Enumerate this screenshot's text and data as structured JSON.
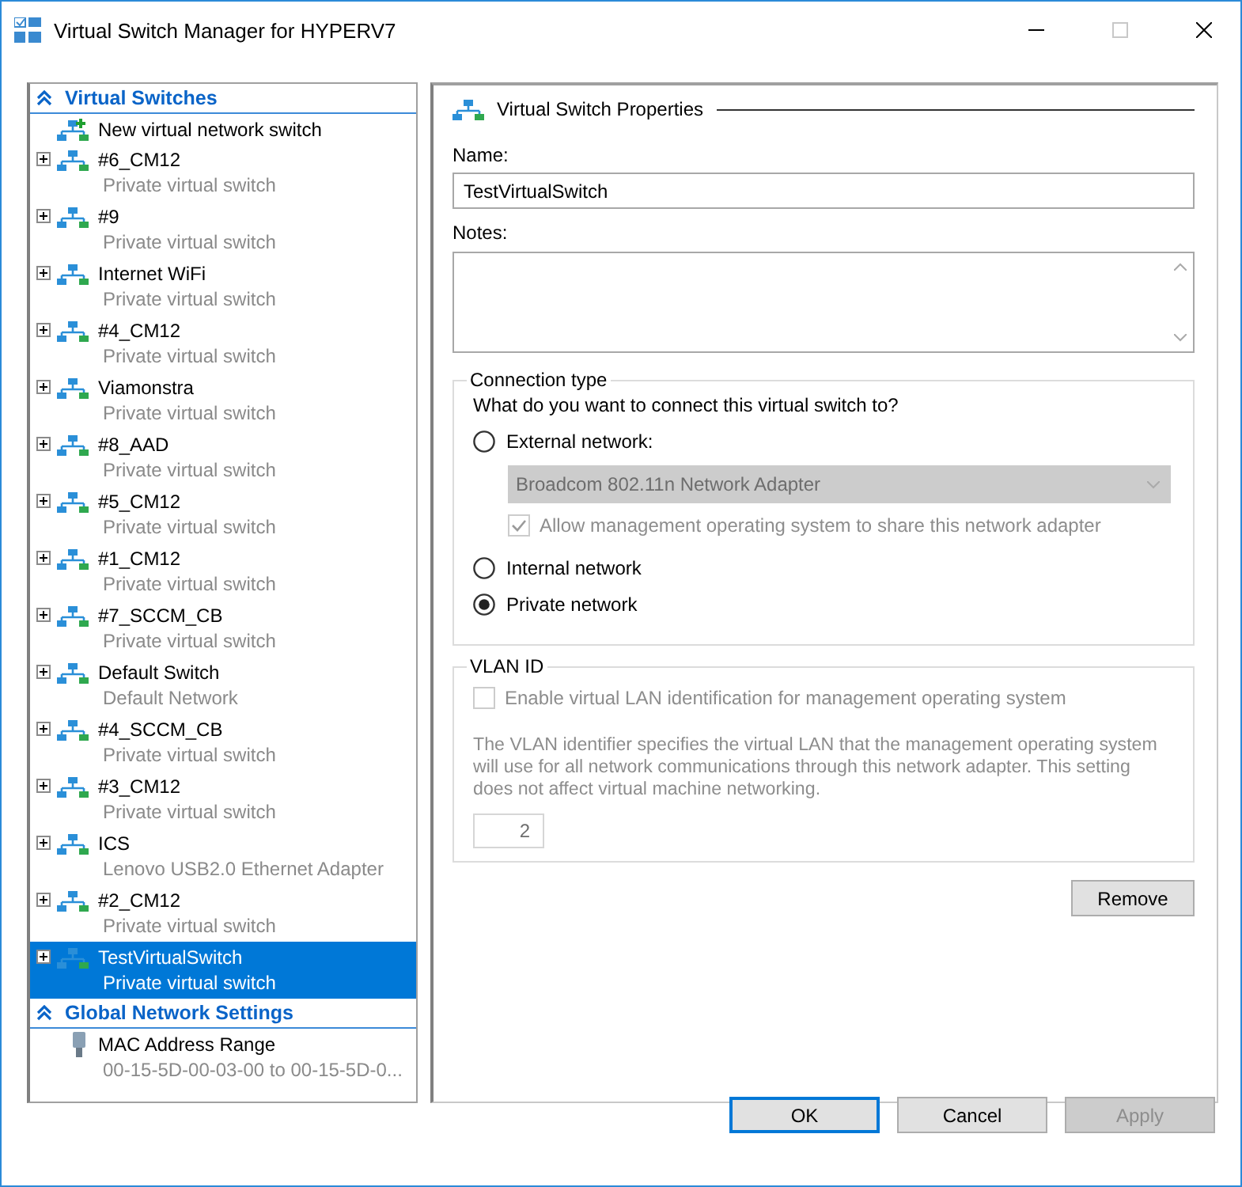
{
  "window": {
    "title": "Virtual Switch Manager for HYPERV7"
  },
  "sidebar": {
    "sections": [
      {
        "title": "Virtual Switches",
        "expanded": true,
        "items": [
          {
            "kind": "action",
            "name": "New virtual network switch",
            "selected": false
          },
          {
            "kind": "switch",
            "name": "#6_CM12",
            "subtitle": "Private virtual switch",
            "expanded": false,
            "selected": false
          },
          {
            "kind": "switch",
            "name": "#9",
            "subtitle": "Private virtual switch",
            "expanded": false,
            "selected": false
          },
          {
            "kind": "switch",
            "name": "Internet WiFi",
            "subtitle": "Private virtual switch",
            "expanded": false,
            "selected": false
          },
          {
            "kind": "switch",
            "name": "#4_CM12",
            "subtitle": "Private virtual switch",
            "expanded": false,
            "selected": false
          },
          {
            "kind": "switch",
            "name": "Viamonstra",
            "subtitle": "Private virtual switch",
            "expanded": false,
            "selected": false
          },
          {
            "kind": "switch",
            "name": "#8_AAD",
            "subtitle": "Private virtual switch",
            "expanded": false,
            "selected": false
          },
          {
            "kind": "switch",
            "name": "#5_CM12",
            "subtitle": "Private virtual switch",
            "expanded": false,
            "selected": false
          },
          {
            "kind": "switch",
            "name": "#1_CM12",
            "subtitle": "Private virtual switch",
            "expanded": false,
            "selected": false
          },
          {
            "kind": "switch",
            "name": "#7_SCCM_CB",
            "subtitle": "Private virtual switch",
            "expanded": false,
            "selected": false
          },
          {
            "kind": "switch",
            "name": "Default Switch",
            "subtitle": "Default Network",
            "expanded": false,
            "selected": false
          },
          {
            "kind": "switch",
            "name": "#4_SCCM_CB",
            "subtitle": "Private virtual switch",
            "expanded": false,
            "selected": false
          },
          {
            "kind": "switch",
            "name": "#3_CM12",
            "subtitle": "Private virtual switch",
            "expanded": false,
            "selected": false
          },
          {
            "kind": "switch",
            "name": "ICS",
            "subtitle": "Lenovo USB2.0 Ethernet Adapter",
            "expanded": false,
            "selected": false
          },
          {
            "kind": "switch",
            "name": "#2_CM12",
            "subtitle": "Private virtual switch",
            "expanded": false,
            "selected": false
          },
          {
            "kind": "switch",
            "name": "TestVirtualSwitch",
            "subtitle": "Private virtual switch",
            "expanded": false,
            "selected": true
          }
        ]
      },
      {
        "title": "Global Network Settings",
        "expanded": true,
        "items": [
          {
            "kind": "setting",
            "name": "MAC Address Range",
            "subtitle": "00-15-5D-00-03-00 to 00-15-5D-0...",
            "selected": false
          }
        ]
      }
    ]
  },
  "properties": {
    "heading": "Virtual Switch Properties",
    "name_label": "Name:",
    "name_value": "TestVirtualSwitch",
    "notes_label": "Notes:",
    "connection": {
      "title": "Connection type",
      "question": "What do you want to connect this virtual switch to?",
      "options": [
        {
          "label": "External network:",
          "selected": false,
          "adapter": {
            "value": "Broadcom 802.11n Network Adapter",
            "disabled": true
          },
          "share": {
            "label": "Allow management operating system to share this network adapter",
            "checked": true,
            "disabled": true
          }
        },
        {
          "label": "Internal network",
          "selected": false
        },
        {
          "label": "Private network",
          "selected": true
        }
      ]
    },
    "vlan": {
      "title": "VLAN ID",
      "checkbox": {
        "label": "Enable virtual LAN identification for management operating system",
        "checked": false,
        "disabled": true
      },
      "description": "The VLAN identifier specifies the virtual LAN that the management operating system will use for all network communications through this network adapter. This setting does not affect virtual machine networking.",
      "value": "2",
      "disabled": true
    },
    "remove_button": "Remove"
  },
  "buttons": [
    {
      "label": "OK",
      "kind": "default",
      "disabled": false
    },
    {
      "label": "Cancel",
      "kind": "normal",
      "disabled": false
    },
    {
      "label": "Apply",
      "kind": "normal",
      "disabled": true
    }
  ]
}
